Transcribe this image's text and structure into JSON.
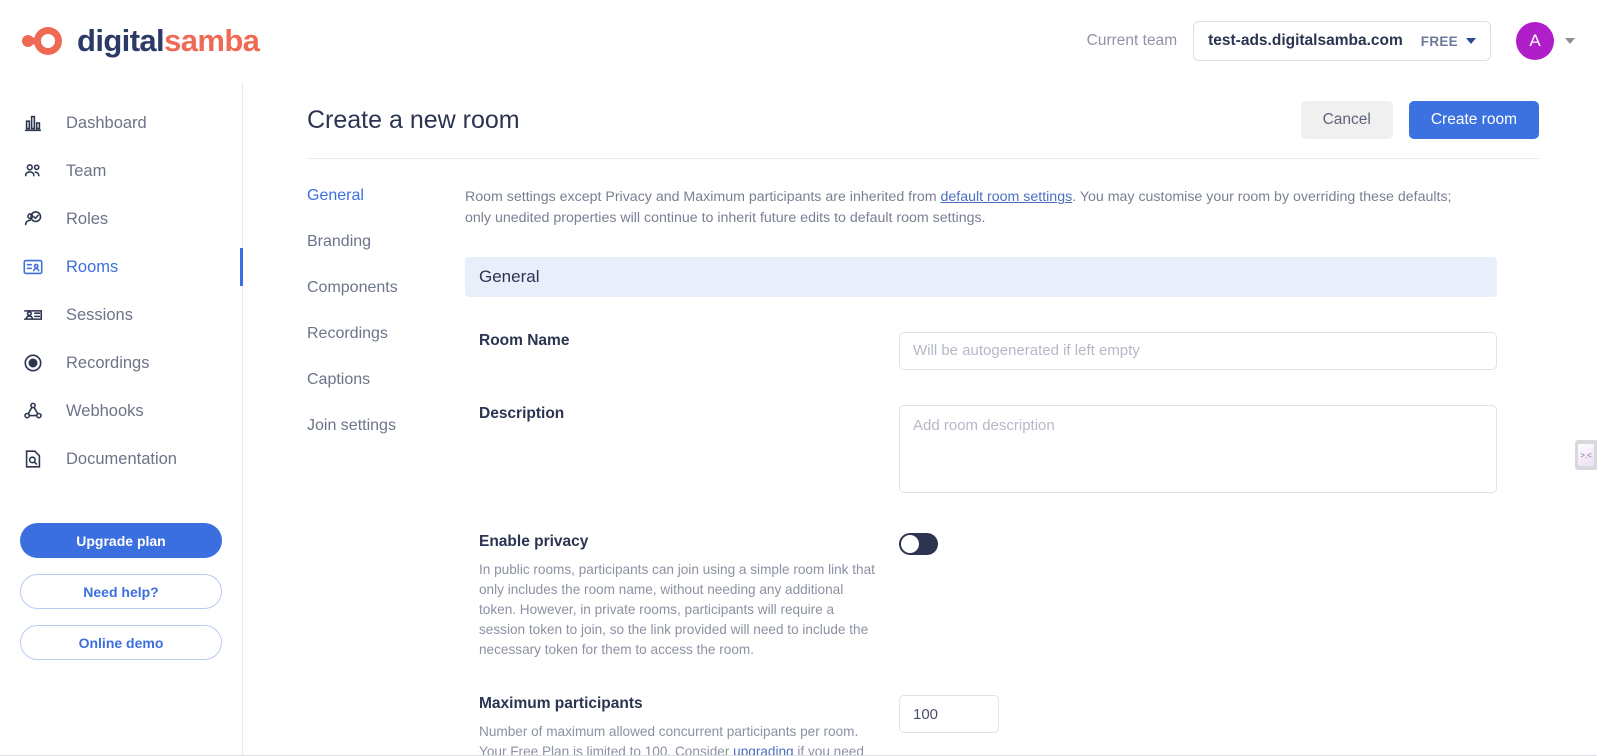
{
  "brand": {
    "name_part1": "digital",
    "name_part2": "samba",
    "color_navy": "#2b3a67",
    "color_coral": "#ef6a55",
    "accent_blue": "#3b6fe0"
  },
  "header": {
    "current_team_label": "Current team",
    "team_name": "test-ads.digitalsamba.com",
    "team_plan": "FREE",
    "avatar_initial": "A"
  },
  "sidebar": {
    "items": [
      {
        "label": "Dashboard",
        "icon": "bar-chart-icon",
        "active": false
      },
      {
        "label": "Team",
        "icon": "people-icon",
        "active": false
      },
      {
        "label": "Roles",
        "icon": "person-check-icon",
        "active": false
      },
      {
        "label": "Rooms",
        "icon": "id-card-icon",
        "active": true
      },
      {
        "label": "Sessions",
        "icon": "contact-card-icon",
        "active": false
      },
      {
        "label": "Recordings",
        "icon": "record-circle-icon",
        "active": false
      },
      {
        "label": "Webhooks",
        "icon": "webhook-icon",
        "active": false
      },
      {
        "label": "Documentation",
        "icon": "document-search-icon",
        "active": false
      }
    ],
    "buttons": {
      "upgrade": "Upgrade plan",
      "help": "Need help?",
      "demo": "Online demo"
    }
  },
  "page": {
    "title": "Create a new room",
    "cancel_label": "Cancel",
    "create_label": "Create room"
  },
  "tabs": [
    {
      "label": "General",
      "active": true
    },
    {
      "label": "Branding",
      "active": false
    },
    {
      "label": "Components",
      "active": false
    },
    {
      "label": "Recordings",
      "active": false
    },
    {
      "label": "Captions",
      "active": false
    },
    {
      "label": "Join settings",
      "active": false
    }
  ],
  "info": {
    "part1": "Room settings except Privacy and Maximum participants are inherited from ",
    "link": "default room settings",
    "part2": ". You may customise your room by overriding these defaults; only unedited properties will continue to inherit future edits to default room settings."
  },
  "section": {
    "title": "General"
  },
  "fields": {
    "room_name": {
      "label": "Room Name",
      "placeholder": "Will be autogenerated if left empty",
      "value": ""
    },
    "description": {
      "label": "Description",
      "placeholder": "Add room description",
      "value": ""
    },
    "enable_privacy": {
      "label": "Enable privacy",
      "help": "In public rooms, participants can join using a simple room link that only includes the room name, without needing any additional token. However, in private rooms, participants will require a session token to join, so the link provided will need to include the necessary token for them to access the room.",
      "toggle_state": "off"
    },
    "max_participants": {
      "label": "Maximum participants",
      "value": "100",
      "help_part1": "Number of maximum allowed concurrent participants per room. Your Free Plan is limited to 100. Consider ",
      "help_link": "upgrading",
      "help_part2": " if you need"
    }
  },
  "side_widget": {
    "glyph": ">.<"
  }
}
